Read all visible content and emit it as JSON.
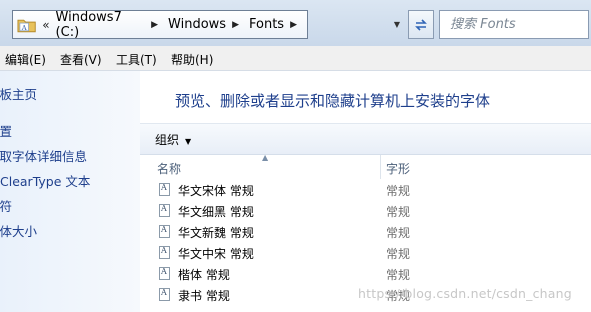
{
  "address_bar": {
    "chevron": "«",
    "segments": [
      "Windows7 (C:)",
      "Windows",
      "Fonts"
    ],
    "folder_icon": "folder-icon",
    "refresh_icon": "refresh-icon",
    "search_placeholder": "搜索 Fonts"
  },
  "menu": {
    "items": [
      "编辑(E)",
      "查看(V)",
      "工具(T)",
      "帮助(H)"
    ]
  },
  "nav": {
    "items": [
      "面板主页",
      "设置",
      "获取字体详细信息",
      "ClearType 文本",
      "字符",
      "字体大小"
    ]
  },
  "main": {
    "heading": "预览、删除或者显示和隐藏计算机上安装的字体",
    "organize_label": "组织",
    "columns": [
      "名称",
      "字形"
    ],
    "rows": [
      {
        "name": "华文宋体 常规",
        "type": "常规"
      },
      {
        "name": "华文细黑 常规",
        "type": "常规"
      },
      {
        "name": "华文新魏 常规",
        "type": "常规"
      },
      {
        "name": "华文中宋 常规",
        "type": "常规"
      },
      {
        "name": "楷体 常规",
        "type": "常规"
      },
      {
        "name": "隶书 常规",
        "type": "常规"
      }
    ]
  },
  "watermark": "https://blog.csdn.net/csdn_chang",
  "colors": {
    "link_blue": "#1e3f8c",
    "nav_bg": "#e9f1fb",
    "address_bg": "#dbe6f2"
  }
}
